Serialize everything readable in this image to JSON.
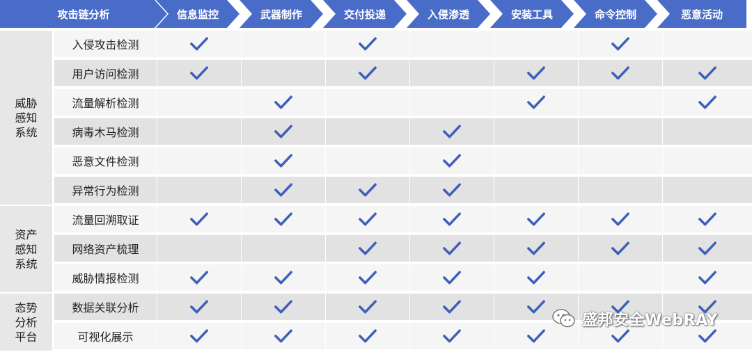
{
  "colors": {
    "header": "#4a6cc9",
    "check": "#3d5fb8"
  },
  "header": {
    "corner_label": "攻击链分析",
    "stages": [
      "信息监控",
      "武器制作",
      "交付投递",
      "入侵渗透",
      "安装工具",
      "命令控制",
      "恶意活动"
    ]
  },
  "groups": [
    {
      "label": "威胁感知系统",
      "rows": 6
    },
    {
      "label": "资产感知系统",
      "rows": 3
    },
    {
      "label": "态势分析平台",
      "rows": 2
    }
  ],
  "rows": [
    {
      "label": "入侵攻击检测",
      "checks": [
        1,
        0,
        1,
        0,
        0,
        1,
        0
      ]
    },
    {
      "label": "用户访问检测",
      "checks": [
        1,
        0,
        1,
        0,
        1,
        1,
        1
      ]
    },
    {
      "label": "流量解析检测",
      "checks": [
        0,
        1,
        0,
        0,
        1,
        0,
        1
      ]
    },
    {
      "label": "病毒木马检测",
      "checks": [
        0,
        1,
        0,
        1,
        0,
        0,
        0
      ]
    },
    {
      "label": "恶意文件检测",
      "checks": [
        0,
        1,
        0,
        1,
        0,
        0,
        0
      ]
    },
    {
      "label": "异常行为检测",
      "checks": [
        0,
        1,
        1,
        1,
        0,
        0,
        0
      ]
    },
    {
      "label": "流量回溯取证",
      "checks": [
        1,
        1,
        1,
        1,
        1,
        1,
        1
      ]
    },
    {
      "label": "网络资产梳理",
      "checks": [
        0,
        0,
        1,
        1,
        1,
        1,
        1
      ]
    },
    {
      "label": "威胁情报检测",
      "checks": [
        1,
        1,
        1,
        1,
        1,
        0,
        1
      ]
    },
    {
      "label": "数据关联分析",
      "checks": [
        1,
        1,
        1,
        1,
        1,
        1,
        1
      ]
    },
    {
      "label": "可视化展示",
      "checks": [
        1,
        1,
        1,
        1,
        1,
        1,
        1
      ]
    }
  ],
  "watermark": {
    "text": "盛邦安全WebRAY",
    "icon": "wechat-icon"
  }
}
